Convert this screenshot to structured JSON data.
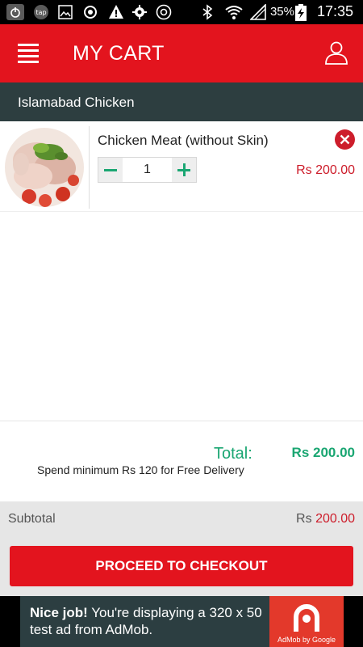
{
  "status_bar": {
    "battery_percent": "35%",
    "time": "17:35",
    "icons": [
      "power-icon",
      "tap-icon",
      "image-icon",
      "sync-icon",
      "warning-icon",
      "settings-icon",
      "chrome-icon",
      "bluetooth-icon",
      "wifi-icon",
      "signal-icon",
      "battery-charging-icon"
    ]
  },
  "header": {
    "title": "MY CART",
    "menu_icon": "hamburger-menu-icon",
    "user_icon": "user-profile-icon"
  },
  "store": {
    "name": "Islamabad Chicken"
  },
  "cart": {
    "items": [
      {
        "name": "Chicken Meat (without Skin)",
        "quantity": "1",
        "price": "Rs 200.00"
      }
    ]
  },
  "summary": {
    "total_label": "Total:",
    "total_value": "Rs 200.00",
    "free_delivery_note": "Spend minimum Rs 120 for Free Delivery",
    "subtotal_label": "Subtotal",
    "subtotal_currency": "Rs",
    "subtotal_amount": "200.00",
    "checkout_label": "PROCEED TO CHECKOUT"
  },
  "ad": {
    "bold_text": "Nice job!",
    "text": " You're displaying a 320 x 50 test ad from AdMob.",
    "logo_caption": "AdMob by Google"
  },
  "colors": {
    "primary_red": "#e3141e",
    "store_bar": "#2d3e40",
    "accent_green": "#1aa672",
    "price_red": "#cd1d2b"
  }
}
